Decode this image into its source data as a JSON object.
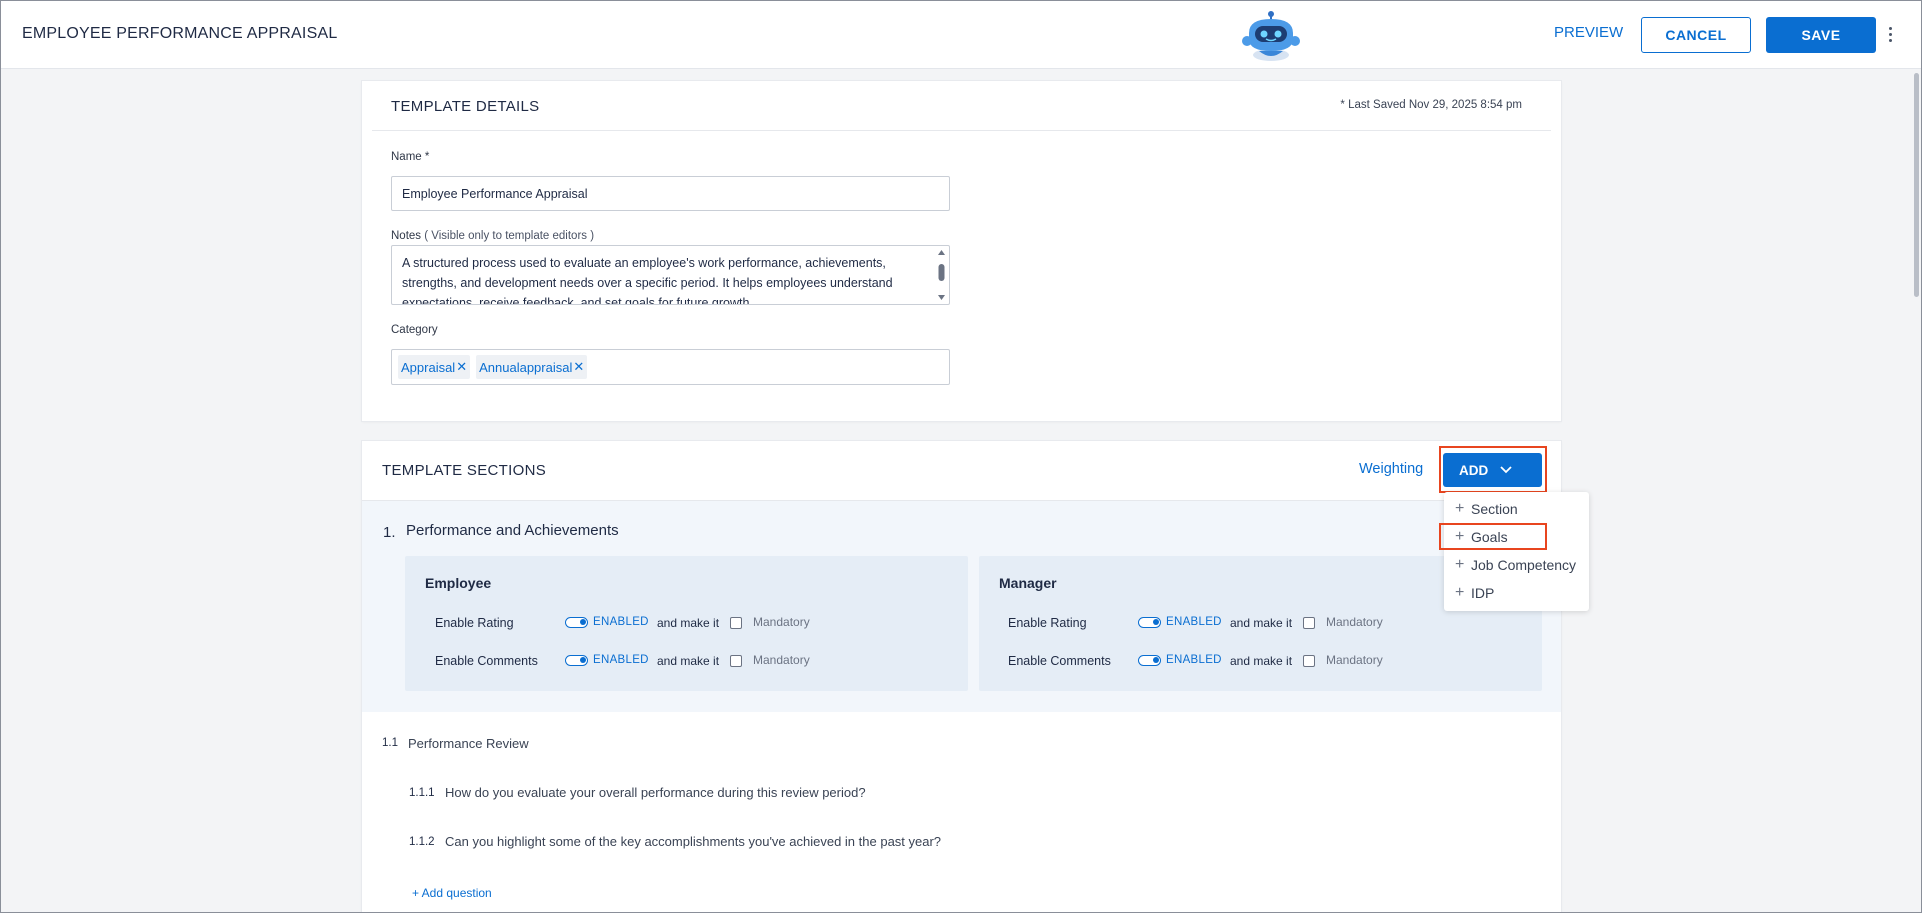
{
  "header": {
    "title": "EMPLOYEE PERFORMANCE APPRAISAL",
    "preview_label": "PREVIEW",
    "cancel_label": "CANCEL",
    "save_label": "SAVE"
  },
  "details": {
    "title": "TEMPLATE DETAILS",
    "last_saved": "* Last Saved Nov 29, 2025 8:54 pm",
    "name_label": "Name *",
    "name_value": "Employee Performance Appraisal",
    "notes_label": "Notes",
    "notes_hint": " ( Visible only to template editors )",
    "notes_value": "A structured process used to evaluate an employee's work performance, achievements, strengths, and development needs over a specific period. It helps employees understand expectations, receive feedback, and set goals for future growth.",
    "category_label": "Category",
    "categories": [
      "Appraisal",
      "Annualappraisal"
    ]
  },
  "sections_panel": {
    "title": "TEMPLATE SECTIONS",
    "weighting_label": "Weighting",
    "add_label": "ADD",
    "add_menu": [
      "Section",
      "Goals",
      "Job Competency",
      "IDP"
    ]
  },
  "section_1": {
    "number": "1.",
    "title": "Performance and Achievements",
    "employee": {
      "title": "Employee",
      "rating_label": "Enable Rating",
      "comments_label": "Enable Comments",
      "enabled_text": "ENABLED",
      "make_it": "and make it",
      "mandatory": "Mandatory"
    },
    "manager": {
      "title": "Manager",
      "rating_label": "Enable Rating",
      "comments_label": "Enable Comments",
      "enabled_text": "ENABLED",
      "make_it": "and make it",
      "mandatory": "Mandatory"
    },
    "subsection": {
      "number": "1.1",
      "title": "Performance Review",
      "questions": [
        {
          "number": "1.1.1",
          "text": "How do you evaluate your overall performance during this review period?"
        },
        {
          "number": "1.1.2",
          "text": "Can you highlight some of the key accomplishments you've achieved in the past year?"
        }
      ],
      "add_question_label": "+ Add question"
    }
  },
  "colors": {
    "primary": "#0a6ed1",
    "highlight": "#e8451f",
    "panel_bg": "#e5edf6",
    "band_bg": "#f2f6fb"
  }
}
